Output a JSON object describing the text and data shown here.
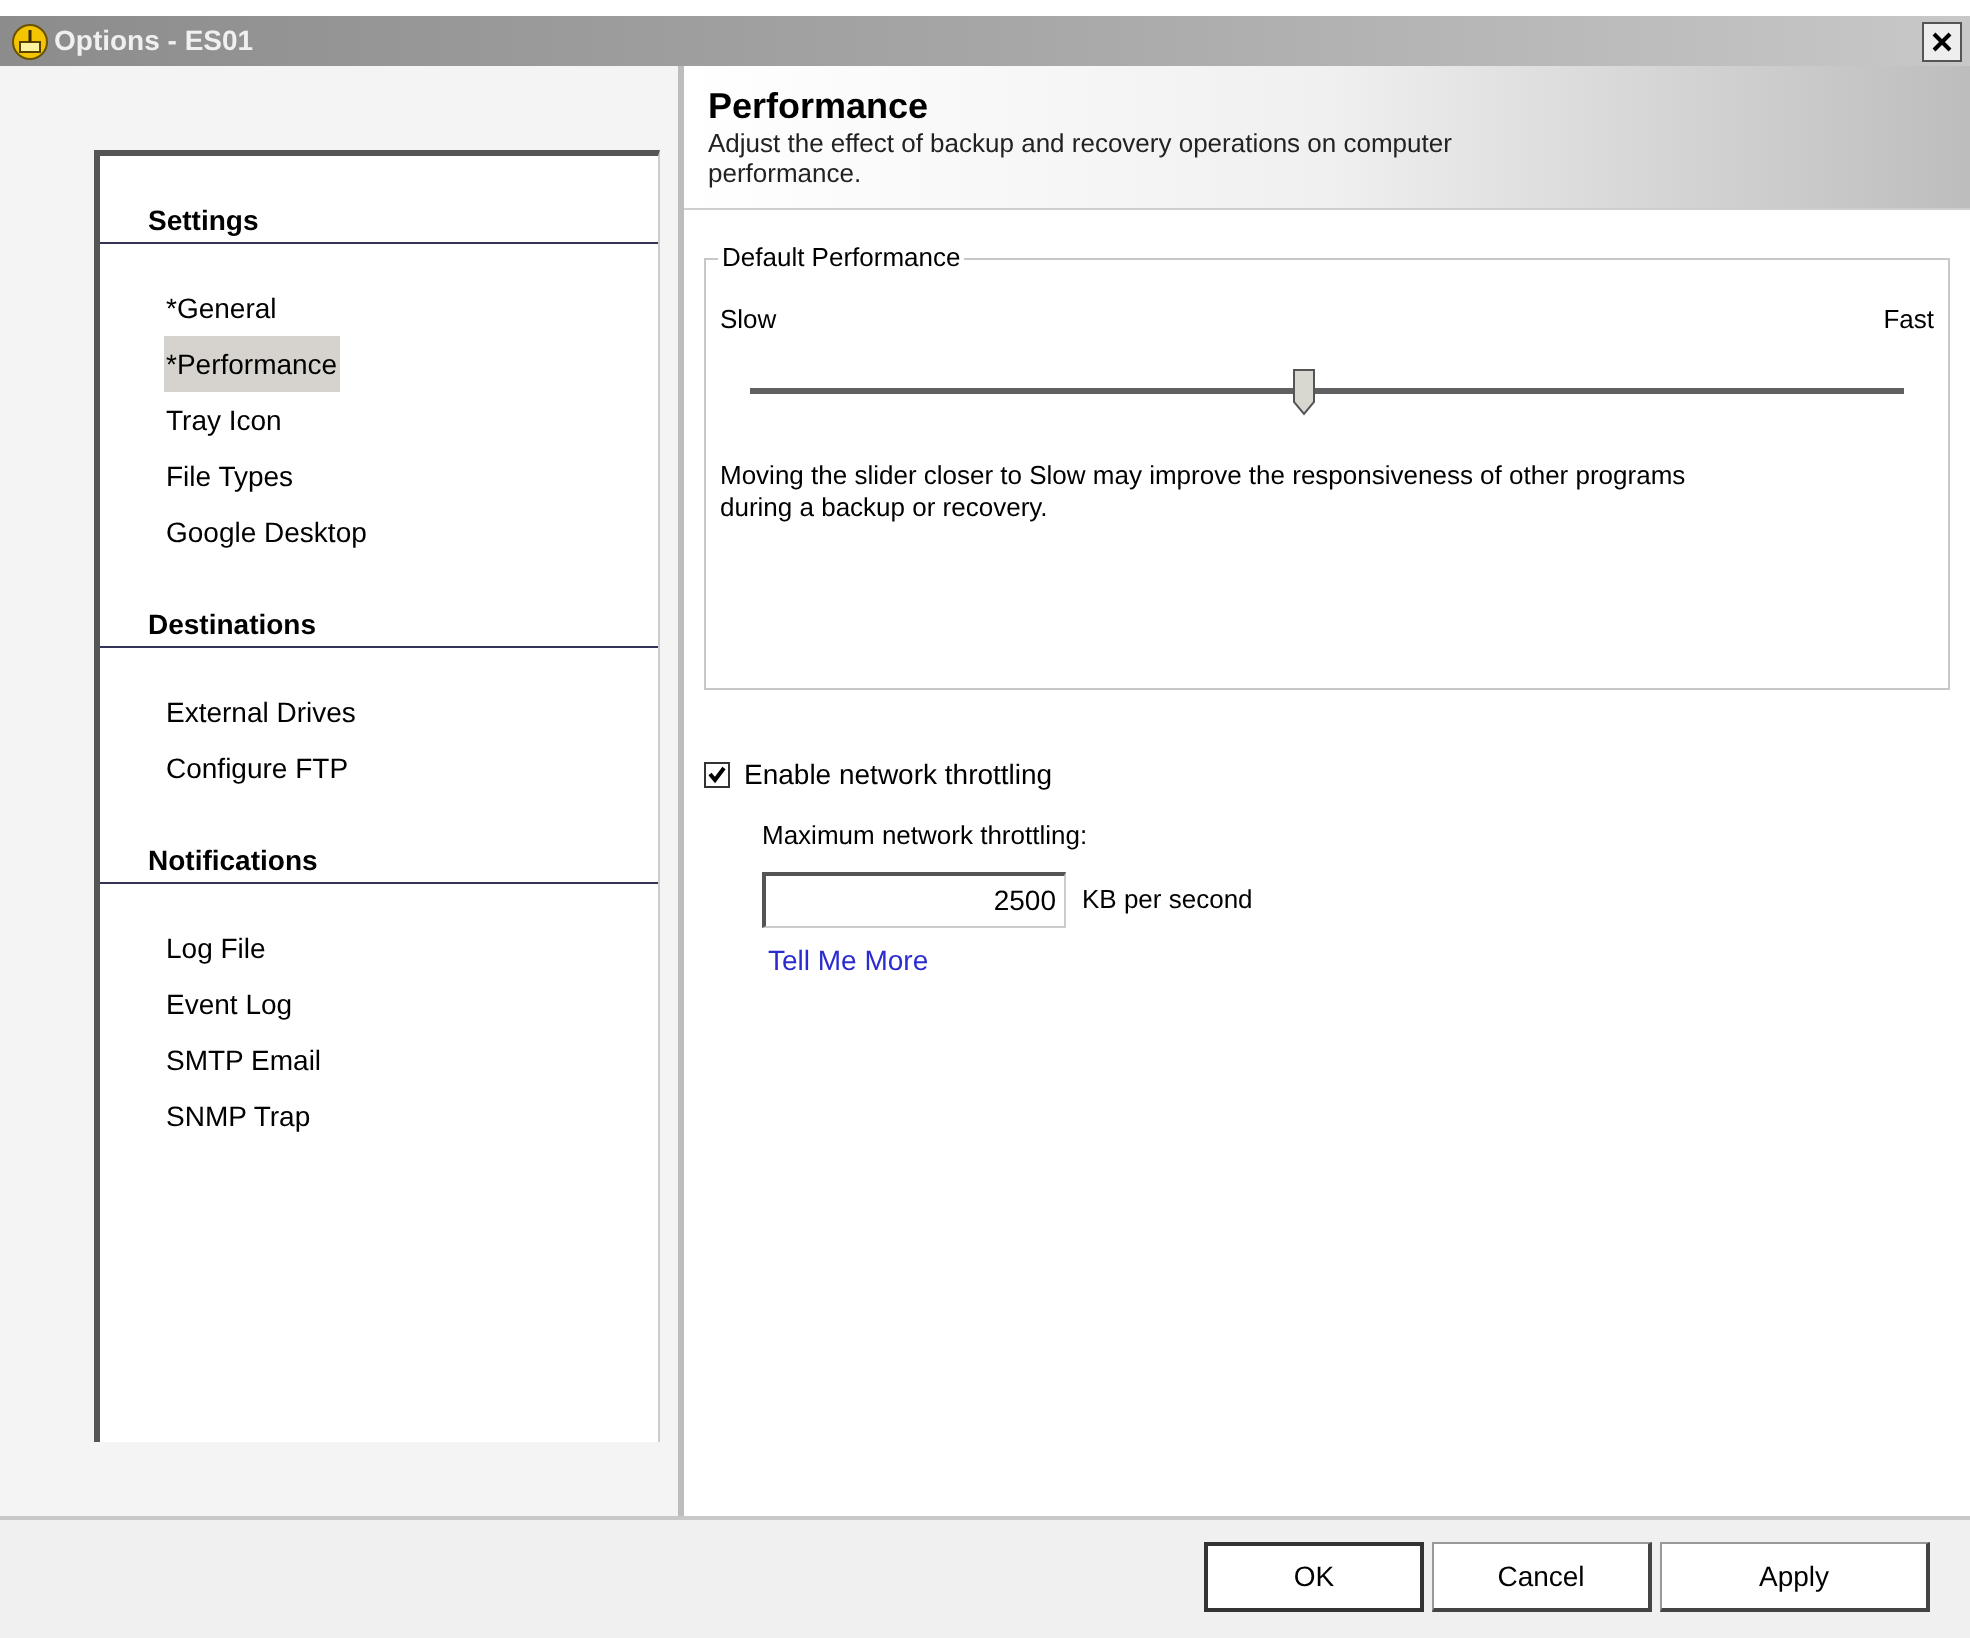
{
  "window": {
    "title": "Options - ES01"
  },
  "sidebar": {
    "sections": [
      {
        "heading": "Settings",
        "items": [
          {
            "label": "*General",
            "selected": false
          },
          {
            "label": "*Performance",
            "selected": true
          },
          {
            "label": "Tray Icon",
            "selected": false
          },
          {
            "label": "File Types",
            "selected": false
          },
          {
            "label": "Google Desktop",
            "selected": false
          }
        ]
      },
      {
        "heading": "Destinations",
        "items": [
          {
            "label": "External Drives",
            "selected": false
          },
          {
            "label": "Configure FTP",
            "selected": false
          }
        ]
      },
      {
        "heading": "Notifications",
        "items": [
          {
            "label": "Log File",
            "selected": false
          },
          {
            "label": "Event Log",
            "selected": false
          },
          {
            "label": "SMTP Email",
            "selected": false
          },
          {
            "label": "SNMP Trap",
            "selected": false
          }
        ]
      }
    ]
  },
  "header": {
    "title": "Performance",
    "description": "Adjust the effect of backup and recovery operations on computer performance."
  },
  "performance_group": {
    "legend": "Default Performance",
    "min_label": "Slow",
    "max_label": "Fast",
    "level": 0.48,
    "note": "Moving the slider closer to Slow may improve the responsiveness of other programs during a backup or recovery."
  },
  "throttling": {
    "label": "Enable network throttling",
    "checked": true,
    "max_label": "Maximum network throttling:",
    "value": "2500",
    "unit": "KB per second",
    "link": "Tell Me More"
  },
  "buttons": [
    {
      "label": "OK",
      "default": true
    },
    {
      "label": "Cancel",
      "default": false
    },
    {
      "label": "Apply",
      "default": false
    }
  ]
}
